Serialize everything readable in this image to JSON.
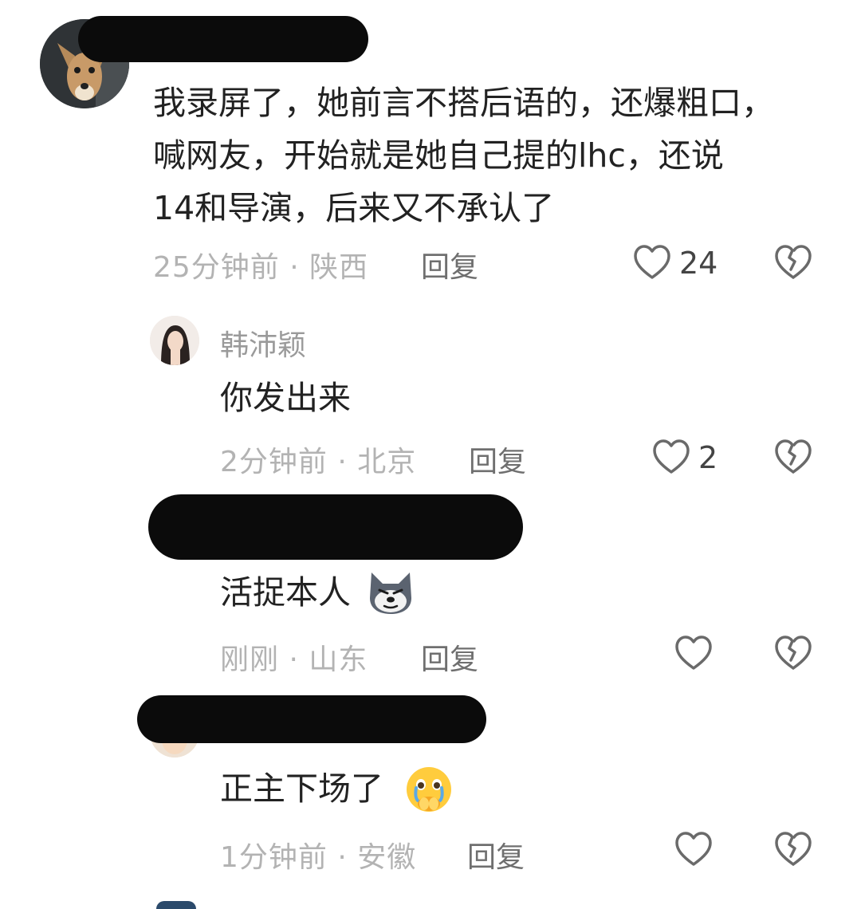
{
  "comments": [
    {
      "text_lines": [
        "我录屏了，她前言不搭后语的，还爆粗口，",
        "喊网友，开始就是她自己提的lhc，还说",
        "14和导演，后来又不承认了"
      ],
      "meta": "25分钟前 · 陕西",
      "reply_label": "回复",
      "like_count": "24"
    },
    {
      "username": "韩沛颖",
      "text": "你发出来",
      "meta": "2分钟前 · 北京",
      "reply_label": "回复",
      "like_count": "2"
    },
    {
      "text": "活捉本人",
      "emoji": "doge-icon",
      "meta": "刚刚 · 山东",
      "reply_label": "回复",
      "like_count": ""
    },
    {
      "text": "正主下场了",
      "emoji": "crying-face-icon",
      "meta": "1分钟前 · 安徽",
      "reply_label": "回复",
      "like_count": ""
    }
  ],
  "colors": {
    "meta_gray": "#b3b3b3",
    "icon_gray": "#6a6a6a",
    "redaction": "#0b0b0b"
  }
}
